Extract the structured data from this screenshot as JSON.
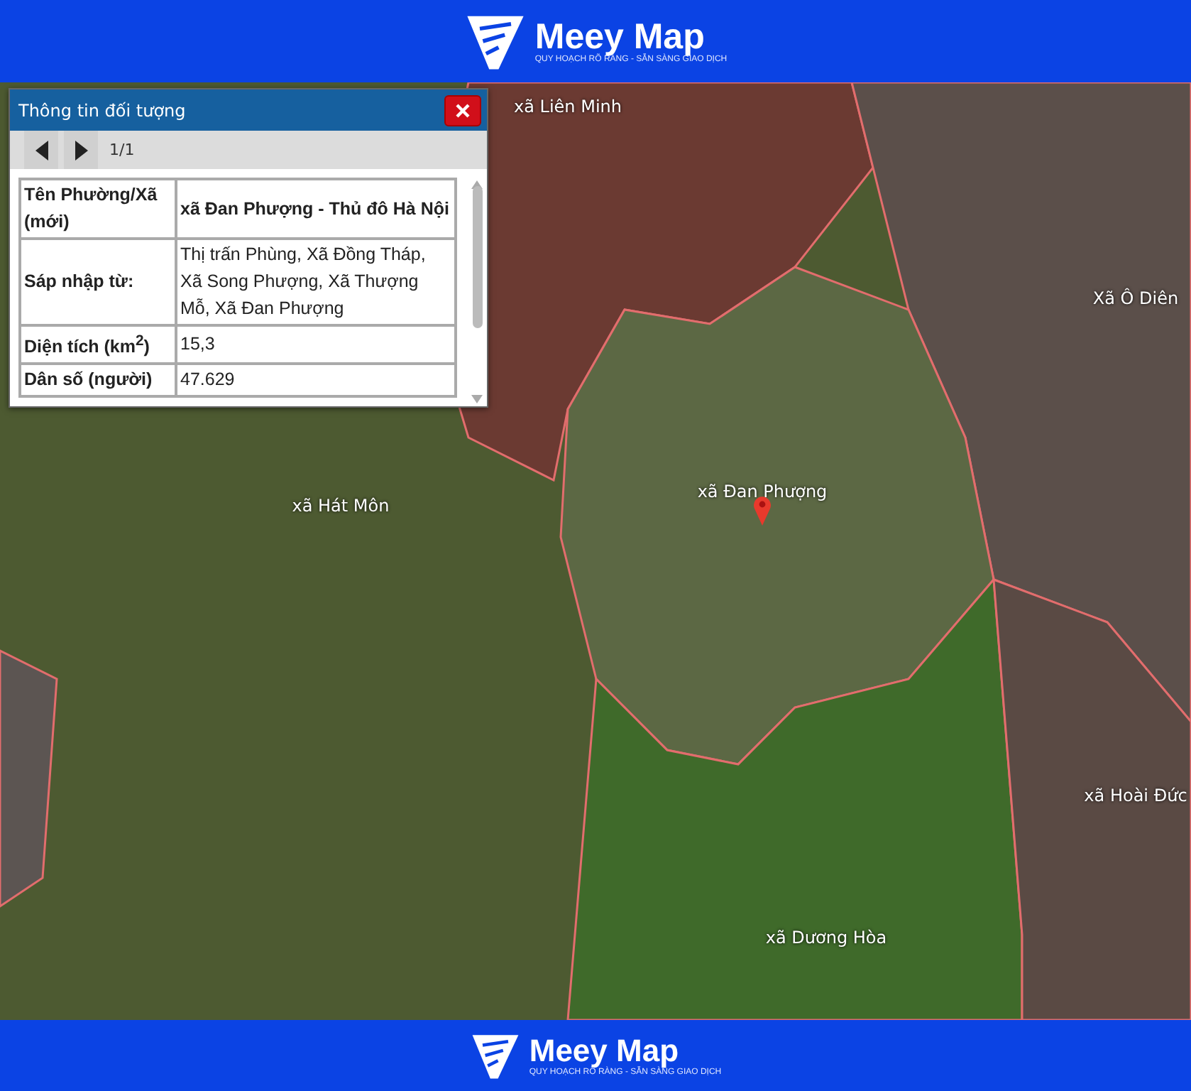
{
  "header": {
    "brand": "Meey Map",
    "tagline": "QUY HOẠCH RÕ RÀNG - SẴN SÀNG GIAO DỊCH"
  },
  "map": {
    "labels": [
      "xã Liên Minh",
      "Xã Ô Diên",
      "xã Hát Môn",
      "xã Đan Phượng",
      "xã Hoài Đức",
      "xã Dương Hòa"
    ]
  },
  "popup": {
    "title": "Thông tin đối tượng",
    "pager": "1/1",
    "rows": [
      {
        "label": "Tên Phường/Xã (mới)",
        "value": "xã Đan Phượng - Thủ đô Hà Nội",
        "bold": true
      },
      {
        "label": "Sáp nhập từ:",
        "value": "Thị trấn Phùng, Xã Đồng Tháp, Xã Song Phượng, Xã Thượng Mỗ, Xã Đan Phượng",
        "bold": false
      },
      {
        "label": "Diện tích (km$^{2}$)",
        "value": "15,3",
        "bold": false
      },
      {
        "label": "Dân số (người)",
        "value": "47.629",
        "bold": false
      }
    ]
  },
  "footer": {
    "brand": "Meey Map",
    "tagline": "QUY HOẠCH RÕ RÀNG - SẴN SÀNG GIAO DỊCH"
  }
}
